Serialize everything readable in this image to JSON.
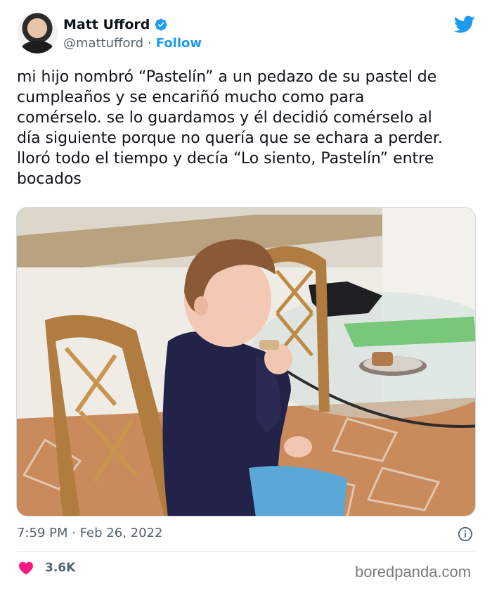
{
  "author": {
    "name": "Matt Ufford",
    "handle": "@mattufford",
    "separator": "·",
    "follow_label": "Follow",
    "avatar_icon": "profile-photo",
    "verified_icon": "verified-badge-icon"
  },
  "platform_icon": "twitter-bird-icon",
  "tweet": {
    "text": "mi hijo nombró “Pastelín” a un pedazo de su pastel de\ncumpleaños y se encariñó mucho como para\ncomérselo. se lo guardamos y él decidió comérselo al\ndía siguiente porque no quería que se echara a perder.\nlloró todo el tiempo y decía “Lo siento, Pastelín” entre\nbocados",
    "timestamp": "7:59 PM · Feb 26, 2022",
    "likes": "3.6K"
  },
  "colors": {
    "accent": "#1d9bf0",
    "heart": "#f91880",
    "secondary_text": "#536471"
  },
  "watermark": "boredpanda.com"
}
